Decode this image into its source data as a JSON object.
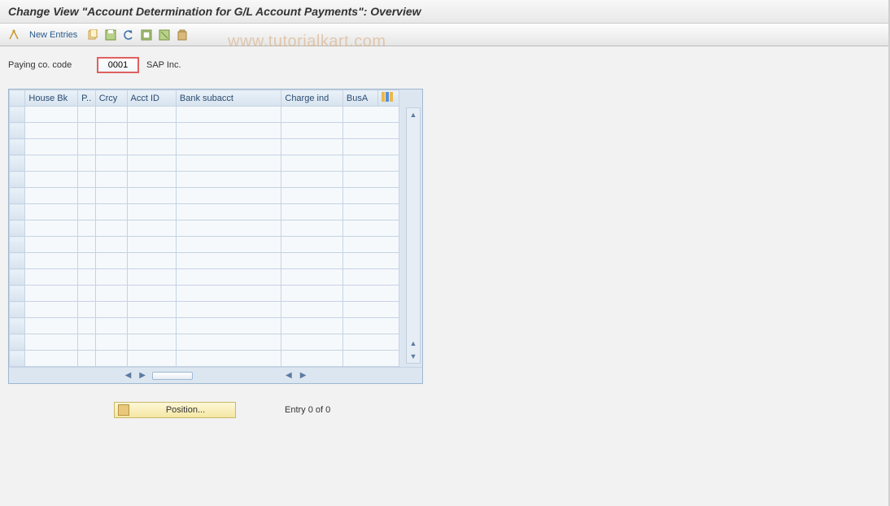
{
  "title": "Change View \"Account Determination for G/L Account Payments\": Overview",
  "watermark": "www.tutorialkart.com",
  "toolbar": {
    "new_entries_label": "New Entries"
  },
  "form": {
    "paying_co_code_label": "Paying co. code",
    "paying_co_code_value": "0001",
    "company_name": "SAP Inc."
  },
  "table": {
    "headers": {
      "house_bk": "House Bk",
      "p": "P..",
      "crcy": "Crcy",
      "acct_id": "Acct ID",
      "bank_subacct": "Bank subacct",
      "charge_ind": "Charge ind",
      "busa": "BusA"
    },
    "row_count": 16
  },
  "footer": {
    "position_label": "Position...",
    "entry_text": "Entry 0 of 0"
  }
}
